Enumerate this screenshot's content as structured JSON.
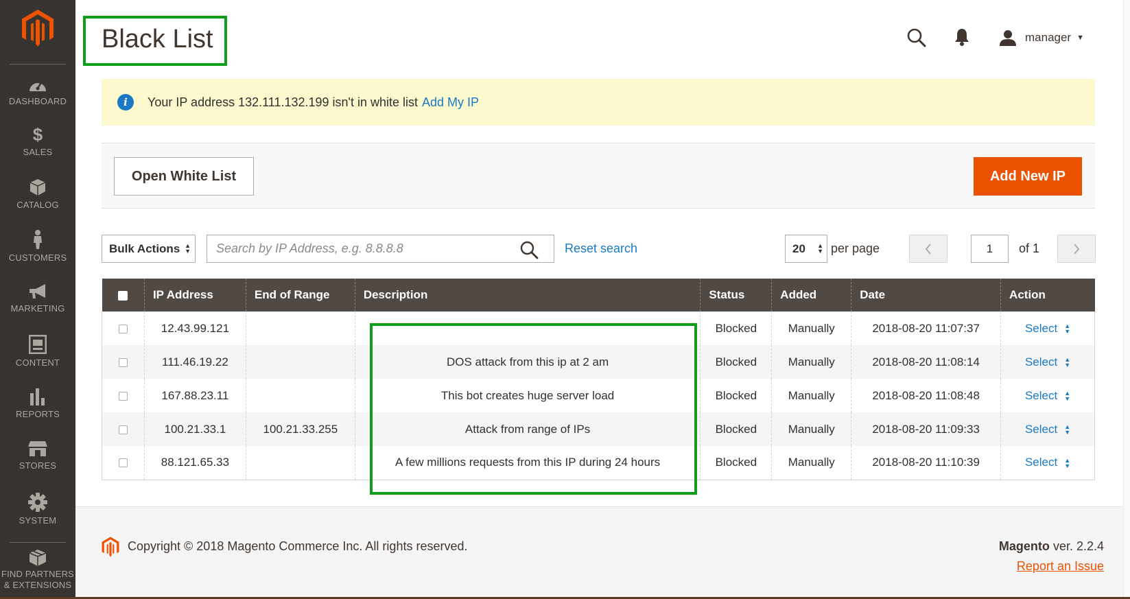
{
  "sidebar": {
    "items": [
      {
        "label": "DASHBOARD"
      },
      {
        "label": "SALES"
      },
      {
        "label": "CATALOG"
      },
      {
        "label": "CUSTOMERS"
      },
      {
        "label": "MARKETING"
      },
      {
        "label": "CONTENT"
      },
      {
        "label": "REPORTS"
      },
      {
        "label": "STORES"
      },
      {
        "label": "SYSTEM"
      },
      {
        "label_line1": "FIND PARTNERS",
        "label_line2": "& EXTENSIONS"
      }
    ]
  },
  "header": {
    "title": "Black List",
    "user_name": "manager"
  },
  "notice": {
    "text": "Your IP address 132.111.132.199 isn't in white list",
    "link": "Add My IP"
  },
  "actions": {
    "open_white_list": "Open White List",
    "add_new_ip": "Add New IP"
  },
  "grid_controls": {
    "bulk_actions": "Bulk Actions",
    "search_placeholder": "Search by IP Address, e.g. 8.8.8.8",
    "reset_search": "Reset search",
    "per_page_value": "20",
    "per_page_label": "per page",
    "current_page": "1",
    "of_pages": "of 1"
  },
  "table": {
    "columns": [
      "IP Address",
      "End of Range",
      "Description",
      "Status",
      "Added",
      "Date",
      "Action"
    ],
    "rows": [
      {
        "ip": "12.43.99.121",
        "end": "",
        "description": "",
        "status": "Blocked",
        "added": "Manually",
        "date": "2018-08-20 11:07:37",
        "action": "Select"
      },
      {
        "ip": "111.46.19.22",
        "end": "",
        "description": "DOS attack from this ip at 2 am",
        "status": "Blocked",
        "added": "Manually",
        "date": "2018-08-20 11:08:14",
        "action": "Select"
      },
      {
        "ip": "167.88.23.11",
        "end": "",
        "description": "This bot creates huge server load",
        "status": "Blocked",
        "added": "Manually",
        "date": "2018-08-20 11:08:48",
        "action": "Select"
      },
      {
        "ip": "100.21.33.1",
        "end": "100.21.33.255",
        "description": "Attack from range of IPs",
        "status": "Blocked",
        "added": "Manually",
        "date": "2018-08-20 11:09:33",
        "action": "Select"
      },
      {
        "ip": "88.121.65.33",
        "end": "",
        "description": "A few millions requests from this IP during 24 hours",
        "status": "Blocked",
        "added": "Manually",
        "date": "2018-08-20 11:10:39",
        "action": "Select"
      }
    ]
  },
  "footer": {
    "copyright": "Copyright © 2018 Magento Commerce Inc. All rights reserved.",
    "brand": "Magento",
    "version": "ver. 2.2.4",
    "report": "Report an Issue"
  },
  "colors": {
    "sidebar_bg": "#373330",
    "accent_orange": "#eb5202",
    "link_blue": "#1979c3",
    "table_header_bg": "#514943",
    "highlight_green": "#0f9e1a",
    "notice_bg": "#fdf9cf"
  }
}
